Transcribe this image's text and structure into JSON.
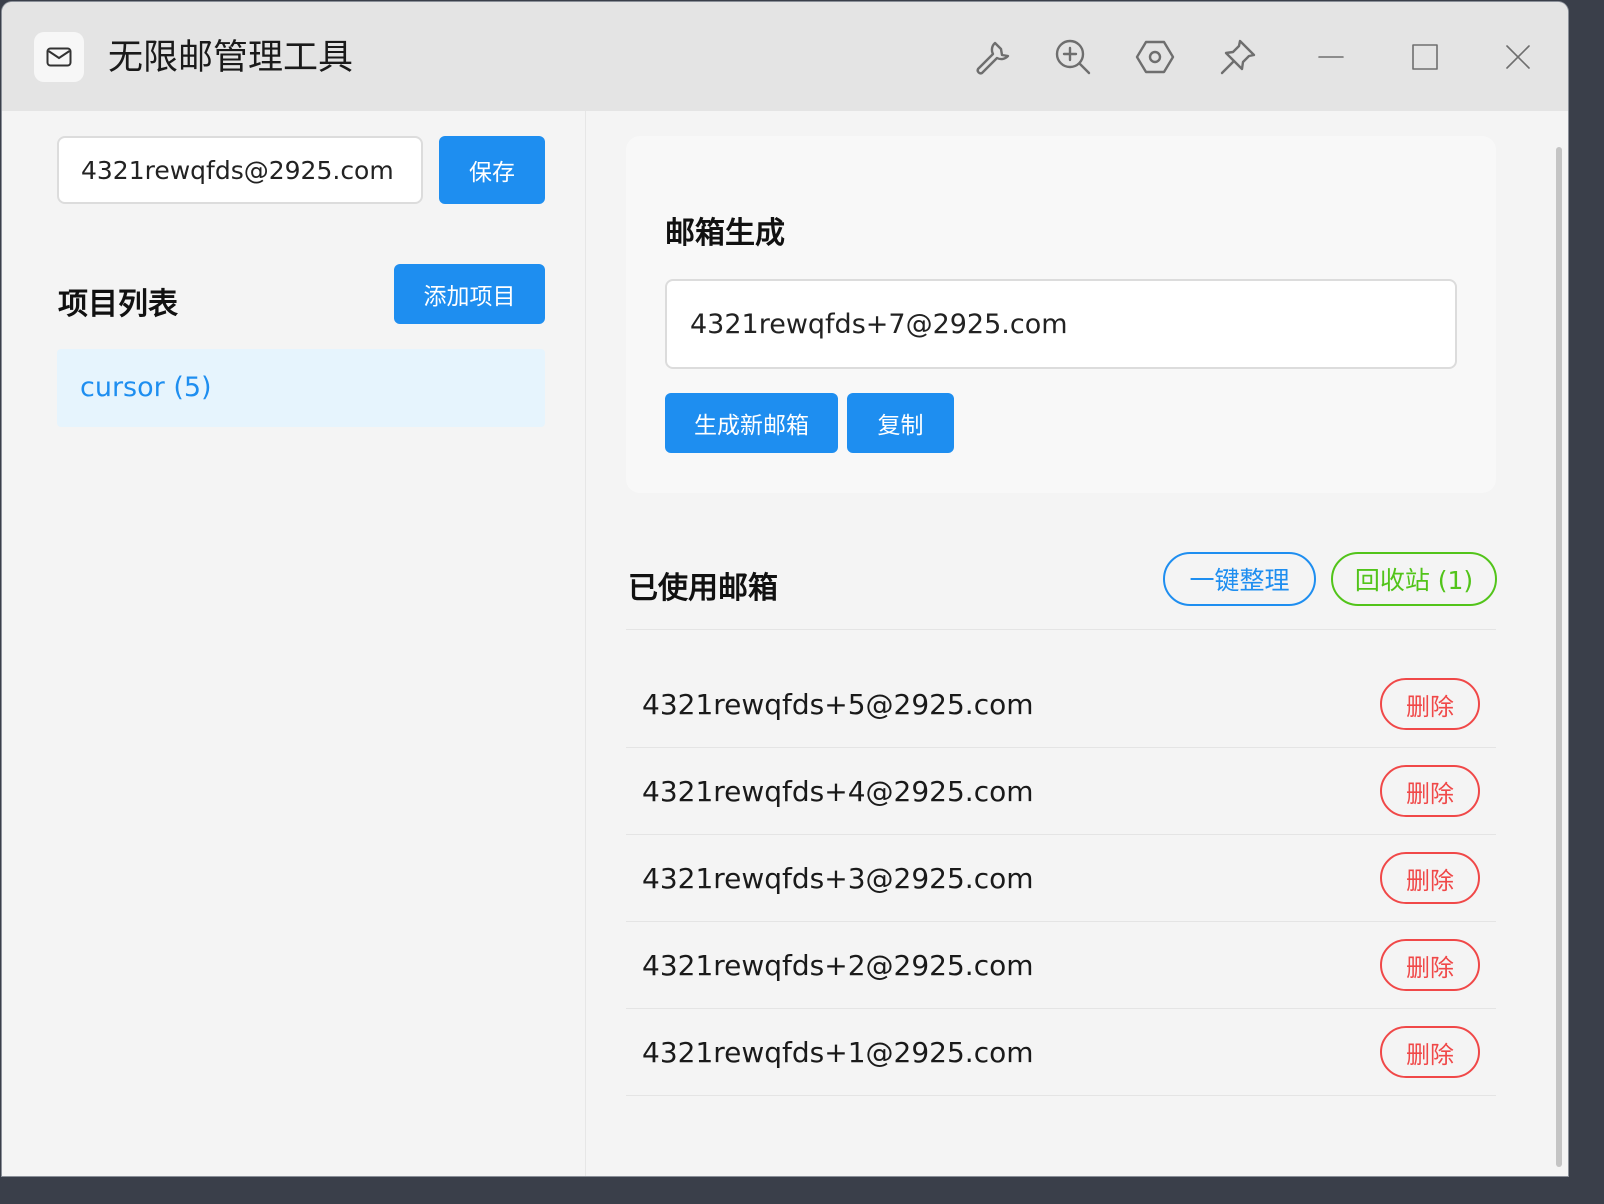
{
  "window": {
    "title": "无限邮管理工具",
    "icons": [
      "mail-icon",
      "wrench-icon",
      "zoom-in-icon",
      "hexagon-settings-icon",
      "pin-icon",
      "minimize-icon",
      "maximize-icon",
      "close-icon"
    ]
  },
  "left": {
    "base_email": "4321rewqfds@2925.com",
    "save_label": "保存",
    "projects_title": "项目列表",
    "add_project_label": "添加项目",
    "projects": [
      {
        "label": "cursor (5)"
      }
    ]
  },
  "generator": {
    "title": "邮箱生成",
    "generated_email": "4321rewqfds+7@2925.com",
    "generate_label": "生成新邮箱",
    "copy_label": "复制"
  },
  "used": {
    "title": "已使用邮箱",
    "organize_label": "一键整理",
    "recycle_label": "回收站 (1)",
    "delete_label": "删除",
    "items": [
      "4321rewqfds+5@2925.com",
      "4321rewqfds+4@2925.com",
      "4321rewqfds+3@2925.com",
      "4321rewqfds+2@2925.com",
      "4321rewqfds+1@2925.com"
    ]
  },
  "colors": {
    "primary": "#1e8ef0",
    "success": "#52c41a",
    "danger": "#f04848"
  }
}
